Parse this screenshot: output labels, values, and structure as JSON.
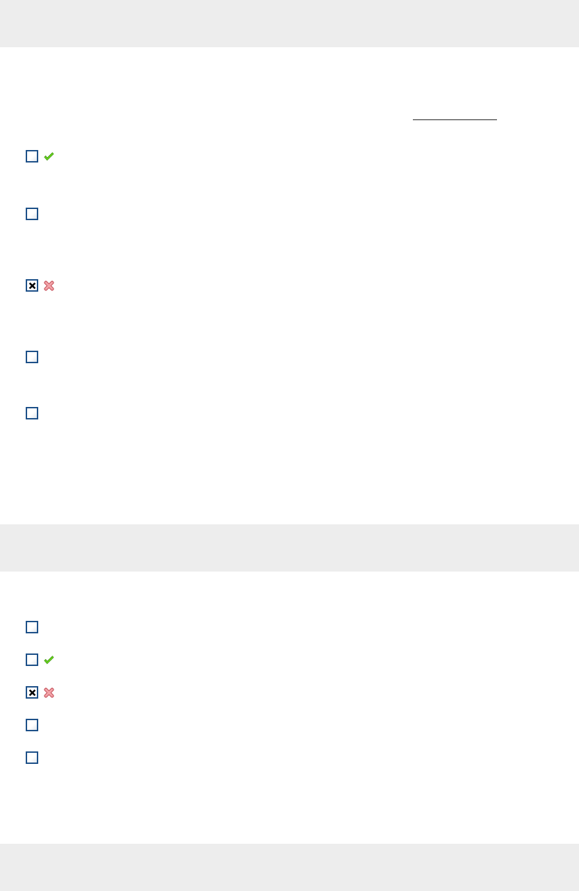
{
  "sections": [
    {
      "blank": true,
      "options": [
        {
          "checked": false,
          "kind": "correct"
        },
        {
          "checked": false,
          "kind": "plain"
        },
        {
          "checked": true,
          "kind": "wrong"
        },
        {
          "checked": false,
          "kind": "plain"
        },
        {
          "checked": false,
          "kind": "plain"
        }
      ]
    },
    {
      "options": [
        {
          "checked": false,
          "kind": "plain"
        },
        {
          "checked": false,
          "kind": "correct"
        },
        {
          "checked": true,
          "kind": "wrong"
        },
        {
          "checked": false,
          "kind": "plain"
        },
        {
          "checked": false,
          "kind": "plain"
        }
      ]
    }
  ]
}
